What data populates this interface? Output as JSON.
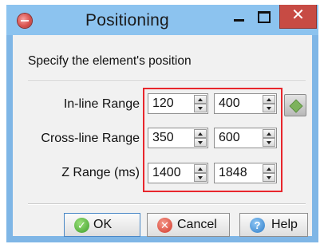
{
  "window": {
    "title": "Positioning",
    "close_glyph": "✕",
    "icons": {
      "app": "app-icon",
      "minimize": "minimize-icon",
      "maximize": "maximize-icon",
      "close": "close-icon"
    },
    "colors": {
      "titlebar": "#8cc3ef",
      "close": "#c74b44",
      "highlight_frame": "#e8262c"
    }
  },
  "dialog": {
    "heading": "Specify the element's position",
    "rows": [
      {
        "label": "In-line Range",
        "from": "120",
        "to": "400"
      },
      {
        "label": "Cross-line Range",
        "from": "350",
        "to": "600"
      },
      {
        "label": "Z Range (ms)",
        "from": "1400",
        "to": "1848"
      }
    ],
    "pick_button_icon": "cube-pick-icon"
  },
  "buttons": {
    "ok": {
      "label": "OK",
      "icon": "check-circle-icon"
    },
    "cancel": {
      "label": "Cancel",
      "icon": "x-circle-icon"
    },
    "help": {
      "label": "Help",
      "icon": "question-circle-icon"
    }
  }
}
